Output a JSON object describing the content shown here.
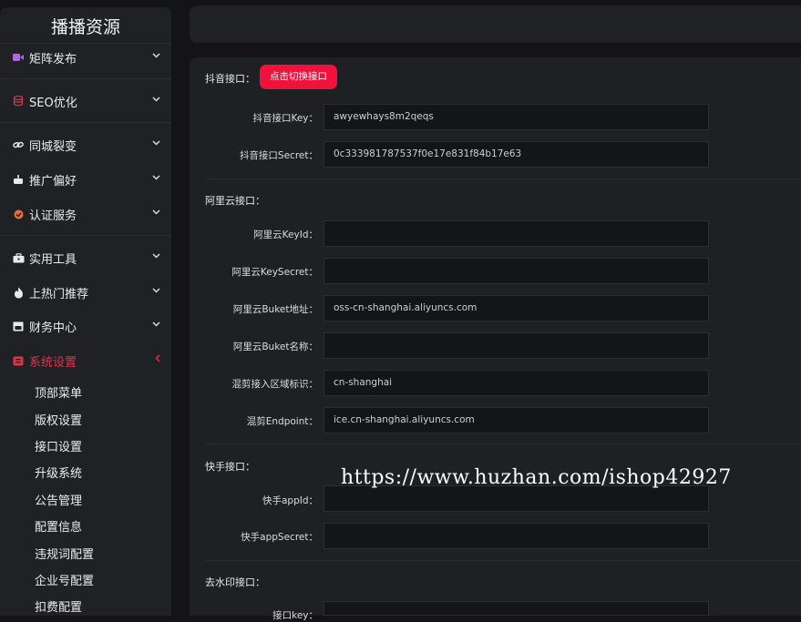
{
  "sidebar": {
    "brand": "播播资源",
    "menu": [
      {
        "label": "矩阵发布",
        "icon": "video-icon"
      },
      {
        "label": "SEO优化",
        "icon": "database-icon"
      },
      {
        "label": "同城裂变",
        "icon": "link-icon"
      },
      {
        "label": "推广偏好",
        "icon": "robot-icon"
      },
      {
        "label": "认证服务",
        "icon": "badge-icon"
      },
      {
        "label": "实用工具",
        "icon": "toolbox-icon"
      },
      {
        "label": "上热门推荐",
        "icon": "fire-icon"
      },
      {
        "label": "财务中心",
        "icon": "calendar-icon"
      },
      {
        "label": "系统设置",
        "icon": "settings-icon"
      }
    ],
    "submenu": [
      "顶部菜单",
      "版权设置",
      "接口设置",
      "升级系统",
      "公告管理",
      "配置信息",
      "违规词配置",
      "企业号配置",
      "扣费配置"
    ]
  },
  "douyin": {
    "title": "抖音接口：",
    "switch_button": "点击切换接口",
    "key_label": "抖音接口Key：",
    "key_value": "awyewhays8m2qeqs",
    "secret_label": "抖音接口Secret：",
    "secret_value": "0c333981787537f0e17e831f84b17e63"
  },
  "aliyun": {
    "title": "阿里云接口：",
    "keyid_label": "阿里云KeyId：",
    "keyid_value": "",
    "keysecret_label": "阿里云KeySecret：",
    "keysecret_value": "",
    "bucket_addr_label": "阿里云Buket地址：",
    "bucket_addr_value": "oss-cn-shanghai.aliyuncs.com",
    "bucket_name_label": "阿里云Buket名称：",
    "bucket_name_value": "",
    "region_label": "混剪接入区域标识：",
    "region_value": "cn-shanghai",
    "endpoint_label": "混剪Endpoint：",
    "endpoint_value": "ice.cn-shanghai.aliyuncs.com"
  },
  "kuaishou": {
    "title": "快手接口：",
    "appid_label": "快手appId：",
    "appid_value": "",
    "appsecret_label": "快手appSecret：",
    "appsecret_value": ""
  },
  "watermark_section": {
    "title": "去水印接口：",
    "key_label": "接口key："
  },
  "overlay": {
    "watermark_text": "https://www.huzhan.com/ishop42927"
  },
  "colors": {
    "accent": "#f0123c",
    "active_menu": "#e0334a",
    "background": "#141417",
    "panel": "#1f2024"
  }
}
